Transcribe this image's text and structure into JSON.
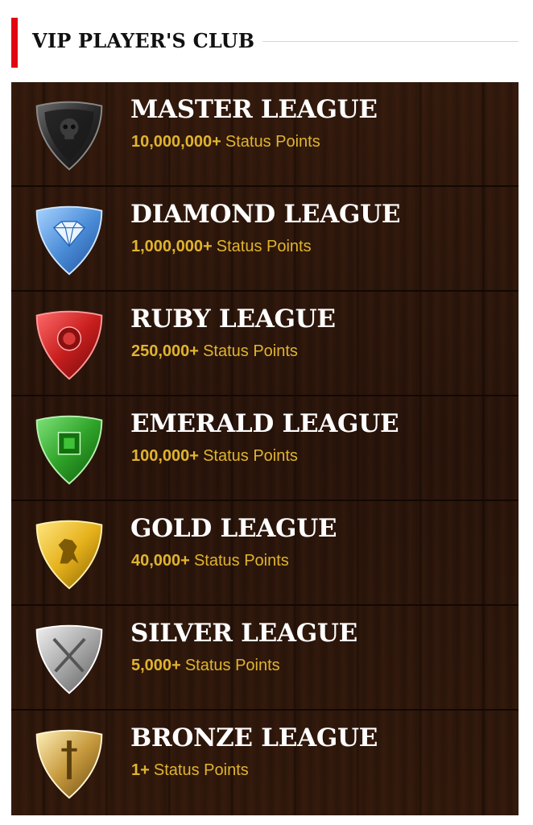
{
  "header": {
    "title": "VIP PLAYER'S CLUB",
    "accent_color": "#e20613"
  },
  "leagues": [
    {
      "name": "MASTER LEAGUE",
      "points": "10,000,000+",
      "points_label": "Status Points",
      "icon": "skull-shield-icon",
      "color": "#2b2b2b"
    },
    {
      "name": "DIAMOND LEAGUE",
      "points": "1,000,000+",
      "points_label": "Status Points",
      "icon": "diamond-shield-icon",
      "color": "#4d8fd9"
    },
    {
      "name": "RUBY LEAGUE",
      "points": "250,000+",
      "points_label": "Status Points",
      "icon": "ruby-shield-icon",
      "color": "#c91f1f"
    },
    {
      "name": "EMERALD LEAGUE",
      "points": "100,000+",
      "points_label": "Status Points",
      "icon": "emerald-shield-icon",
      "color": "#2fa329"
    },
    {
      "name": "GOLD LEAGUE",
      "points": "40,000+",
      "points_label": "Status Points",
      "icon": "lion-shield-icon",
      "color": "#e6b21c"
    },
    {
      "name": "SILVER LEAGUE",
      "points": "5,000+",
      "points_label": "Status Points",
      "icon": "swords-shield-icon",
      "color": "#a8a8a8"
    },
    {
      "name": "BRONZE LEAGUE",
      "points": "1+",
      "points_label": "Status Points",
      "icon": "sword-shield-icon",
      "color": "#c79a3e"
    }
  ],
  "text_color": "#ffffff",
  "points_color": "#e0b42e"
}
